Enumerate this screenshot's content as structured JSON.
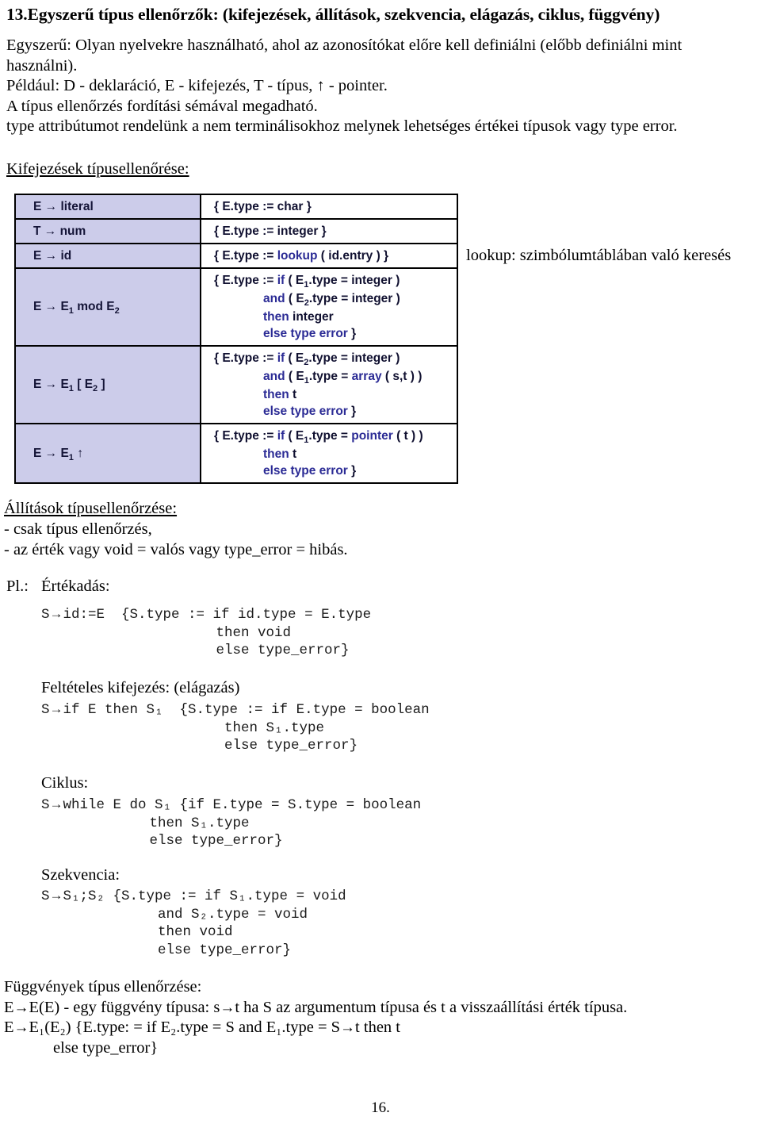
{
  "title": "13.Egyszerű típus ellenőrzők: (kifejezések, állítások, szekvencia, elágazás, ciklus, függvény)",
  "intro": {
    "line1": "Egyszerű: Olyan nyelvekre használható, ahol az azonosítókat előre kell definiálni (előbb definiálni mint használni).",
    "line2": "Például: D - deklaráció, E - kifejezés, T - típus, ↑ - pointer.",
    "line3": "A típus ellenőrzés fordítási sémával megadható.",
    "line4": "type attribútumot rendelünk a nem terminálisokhoz melynek lehetséges értékei típusok vagy type error."
  },
  "expressions": {
    "heading": "Kifejezések típusellenőrése:",
    "lookup_note": "lookup: szimbólumtáblában való keresés",
    "rows": [
      {
        "lhs_pre": "E → literal",
        "lhs_sub": "",
        "lhs_post": "",
        "action_lines": [
          {
            "indent": false,
            "parts": [
              {
                "text": "{ E.type := char }",
                "kw": false
              }
            ]
          }
        ]
      },
      {
        "lhs_pre": "T → num",
        "lhs_sub": "",
        "lhs_post": "",
        "action_lines": [
          {
            "indent": false,
            "parts": [
              {
                "text": "{ E.type := integer }",
                "kw": false
              }
            ]
          }
        ]
      },
      {
        "lhs_pre": "E → id",
        "lhs_sub": "",
        "lhs_post": "",
        "action_lines": [
          {
            "indent": false,
            "parts": [
              {
                "text": "{ E.type := ",
                "kw": false
              },
              {
                "text": "lookup",
                "kw": true
              },
              {
                "text": " ( id.entry ) }",
                "kw": false
              }
            ]
          }
        ]
      },
      {
        "lhs_pre": "E → E",
        "lhs_sub": "1",
        "lhs_post": " mod E",
        "lhs_sub2": "2",
        "action_lines": [
          {
            "indent": false,
            "parts": [
              {
                "text": "{ E.type := ",
                "kw": false
              },
              {
                "text": "if",
                "kw": true
              },
              {
                "text": " ( E",
                "kw": false
              },
              {
                "sub": "1"
              },
              {
                "text": ".type = integer )",
                "kw": false
              }
            ]
          },
          {
            "indent": true,
            "parts": [
              {
                "text": "and",
                "kw": true
              },
              {
                "text": "  ( E",
                "kw": false
              },
              {
                "sub": "2"
              },
              {
                "text": ".type = integer )",
                "kw": false
              }
            ]
          },
          {
            "indent": true,
            "parts": [
              {
                "text": "then",
                "kw": true
              },
              {
                "text": " integer",
                "kw": false
              }
            ]
          },
          {
            "indent": true,
            "parts": [
              {
                "text": "else type error",
                "kw": true
              },
              {
                "text": " }",
                "kw": false
              }
            ]
          }
        ]
      },
      {
        "lhs_pre": "E → E",
        "lhs_sub": "1",
        "lhs_post": " [ E",
        "lhs_sub2": "2",
        "lhs_tail": " ]",
        "action_lines": [
          {
            "indent": false,
            "parts": [
              {
                "text": "{ E.type := ",
                "kw": false
              },
              {
                "text": "if",
                "kw": true
              },
              {
                "text": " ( E",
                "kw": false
              },
              {
                "sub": "2"
              },
              {
                "text": ".type = integer )",
                "kw": false
              }
            ]
          },
          {
            "indent": true,
            "parts": [
              {
                "text": "and",
                "kw": true
              },
              {
                "text": " ( E",
                "kw": false
              },
              {
                "sub": "1"
              },
              {
                "text": ".type = ",
                "kw": false
              },
              {
                "text": "array",
                "kw": true
              },
              {
                "text": " ( s,t ) )",
                "kw": false
              }
            ]
          },
          {
            "indent": true,
            "parts": [
              {
                "text": "then",
                "kw": true
              },
              {
                "text": " t",
                "kw": false
              }
            ]
          },
          {
            "indent": true,
            "parts": [
              {
                "text": "else type error",
                "kw": true
              },
              {
                "text": " }",
                "kw": false
              }
            ]
          }
        ]
      },
      {
        "lhs_pre": "E → E",
        "lhs_sub": "1",
        "lhs_post": " ↑",
        "action_lines": [
          {
            "indent": false,
            "parts": [
              {
                "text": "{ E.type := ",
                "kw": false
              },
              {
                "text": "if",
                "kw": true
              },
              {
                "text": " ( E",
                "kw": false
              },
              {
                "sub": "1"
              },
              {
                "text": ".type = ",
                "kw": false
              },
              {
                "text": "pointer",
                "kw": true
              },
              {
                "text": " ( t ) )",
                "kw": false
              }
            ]
          },
          {
            "indent": true,
            "parts": [
              {
                "text": "then",
                "kw": true
              },
              {
                "text": " t",
                "kw": false
              }
            ]
          },
          {
            "indent": true,
            "parts": [
              {
                "text": "else type error",
                "kw": true
              },
              {
                "text": " }",
                "kw": false
              }
            ]
          }
        ]
      }
    ]
  },
  "statements": {
    "heading": "Állítások típusellenőrzése:",
    "bullet1": "- csak típus ellenőrzés,",
    "bullet2": "- az érték vagy void = valós vagy type_error = hibás.",
    "pl_label": "Pl.:"
  },
  "examples": {
    "assignment": {
      "heading": "Értékadás:",
      "code": "S→id:=E  {S.type := if id.type = E.type\n                     then void\n                     else type_error}"
    },
    "conditional": {
      "heading": "Feltételes kifejezés: (elágazás)",
      "code": "S→if E then S₁  {S.type := if E.type = boolean\n                      then S₁.type\n                      else type_error}"
    },
    "loop": {
      "heading": "Ciklus:",
      "code": "S→while E do S₁ {if E.type = S.type = boolean\n             then S₁.type\n             else type_error}"
    },
    "sequence": {
      "heading": "Szekvencia:",
      "code": "S→S₁;S₂ {S.type := if S₁.type = void\n              and S₂.type = void\n              then void\n              else type_error}"
    }
  },
  "functions": {
    "heading": "Függvények típus ellenőrzése:",
    "line1": "E→E(E) - egy függvény típusa: s→t ha S az argumentum típusa és t a visszaállítási érték típusa.",
    "line2": "E→E₁(E₂) {E.type: = if E₂.type = S and E₁.type = S→t then t",
    "line3": "else type_error}"
  },
  "page_number": "16."
}
